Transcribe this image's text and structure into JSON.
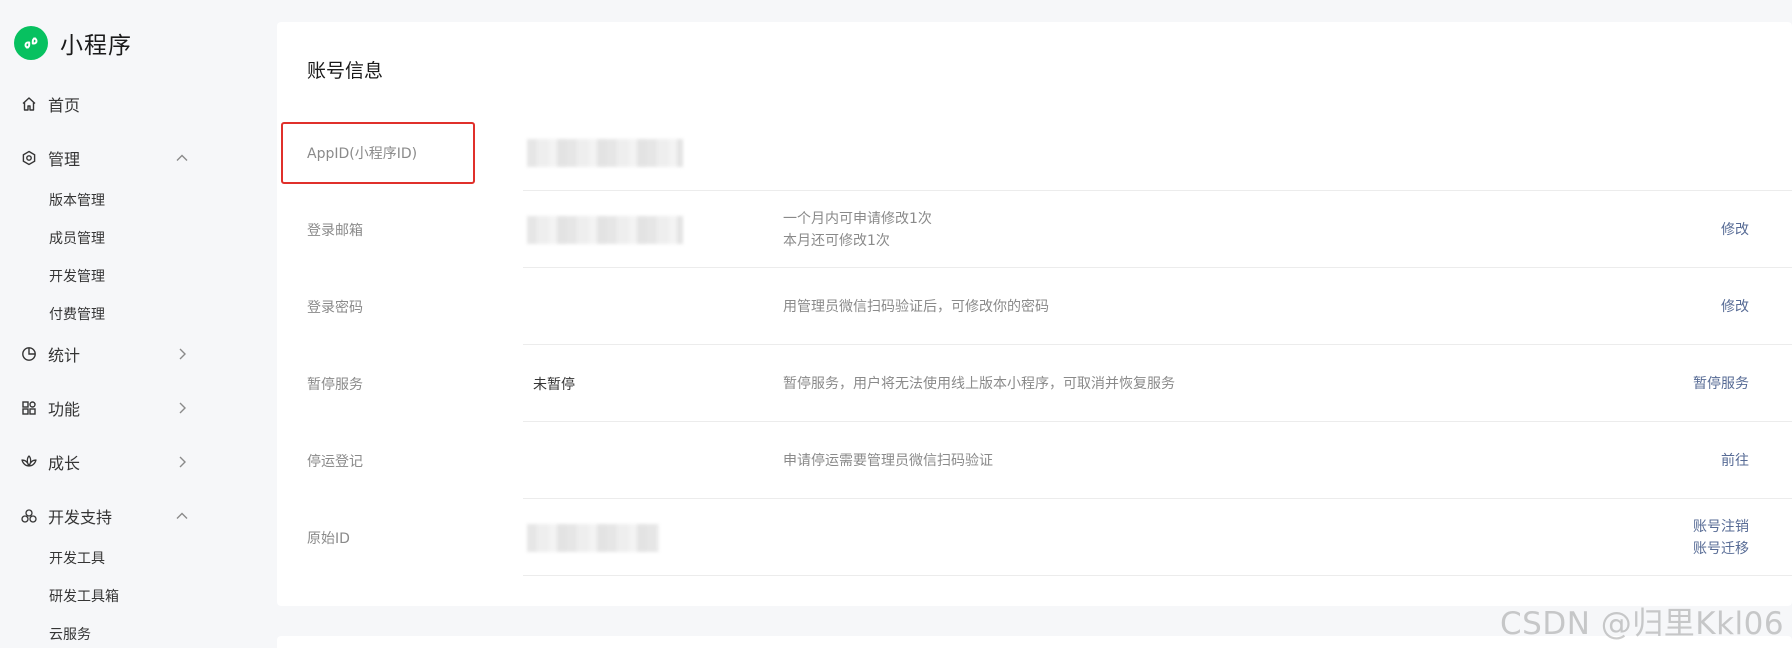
{
  "brand": {
    "title": "小程序"
  },
  "nav": {
    "home": "首页",
    "manage": "管理",
    "manage_items": [
      "版本管理",
      "成员管理",
      "开发管理",
      "付费管理"
    ],
    "stats": "统计",
    "features": "功能",
    "growth": "成长",
    "dev_support": "开发支持",
    "dev_support_items": [
      "开发工具",
      "研发工具箱",
      "云服务"
    ]
  },
  "account": {
    "title": "账号信息",
    "rows": [
      {
        "label": "AppID(小程序ID)",
        "value": "",
        "desc": [],
        "actions": []
      },
      {
        "label": "登录邮箱",
        "value": "",
        "desc": [
          "一个月内可申请修改1次",
          "本月还可修改1次"
        ],
        "actions": [
          "修改"
        ]
      },
      {
        "label": "登录密码",
        "value": "",
        "desc": [
          "用管理员微信扫码验证后，可修改你的密码"
        ],
        "actions": [
          "修改"
        ]
      },
      {
        "label": "暂停服务",
        "value": "未暂停",
        "desc": [
          "暂停服务，用户将无法使用线上版本小程序，可取消并恢复服务"
        ],
        "actions": [
          "暂停服务"
        ]
      },
      {
        "label": "停运登记",
        "value": "",
        "desc": [
          "申请停运需要管理员微信扫码验证"
        ],
        "actions": [
          "前往"
        ]
      },
      {
        "label": "原始ID",
        "value": "",
        "desc": [],
        "actions": [
          "账号注销",
          "账号迁移"
        ]
      }
    ]
  },
  "watermark": "CSDN @归里Kkl06",
  "colors": {
    "brand": "#07c160",
    "link": "#576b95",
    "highlight": "#e0302b"
  }
}
